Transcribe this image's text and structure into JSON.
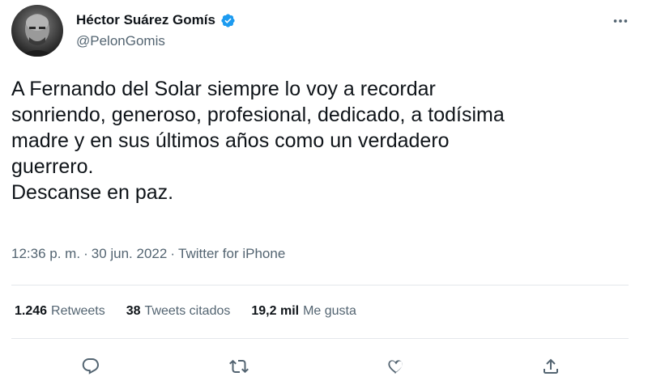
{
  "author": {
    "display_name": "Héctor Suárez Gomís",
    "handle": "@PelonGomis",
    "verified": true
  },
  "tweet": {
    "text": "A Fernando del Solar siempre lo voy a recordar\nsonriendo, generoso, profesional, dedicado, a todísima\nmadre y en sus últimos años como un verdadero\nguerrero.\nDescanse en paz.",
    "time": "12:36 p. m.",
    "separator": "·",
    "date": "30 jun. 2022",
    "source": "Twitter for iPhone"
  },
  "stats": {
    "retweets_count": "1.246",
    "retweets_label": "Retweets",
    "quotes_count": "38",
    "quotes_label": "Tweets citados",
    "likes_count": "19,2 mil",
    "likes_label": "Me gusta"
  },
  "icons": {
    "more": "more-icon",
    "reply": "reply-icon",
    "retweet": "retweet-icon",
    "like": "heart-icon",
    "share": "share-icon",
    "verified": "verified-badge-icon"
  },
  "colors": {
    "text": "#0f1419",
    "secondary": "#536471",
    "verified": "#1d9bf0",
    "divider": "#e4e8eb"
  }
}
